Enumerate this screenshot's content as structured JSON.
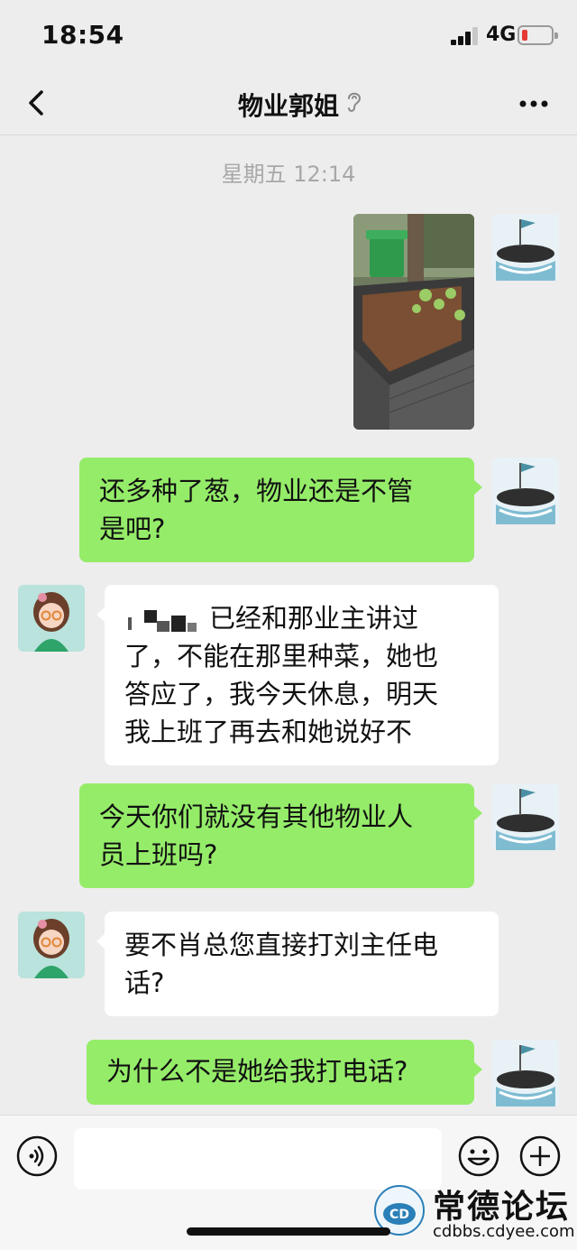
{
  "status_bar": {
    "time": "18:54",
    "network": "4G",
    "battery_level": 0.12,
    "battery_color": "#e53935"
  },
  "nav": {
    "back_icon": "chevron-left-icon",
    "title": "物业郭姐",
    "ear_icon": "ear-icon",
    "more_icon": "ellipsis-icon"
  },
  "chat": {
    "timestamp": "星期五 12:14",
    "messages": [
      {
        "sender": "me",
        "type": "image",
        "image_desc_icon": "photo-thumbnail"
      },
      {
        "sender": "me",
        "type": "text",
        "lines": [
          "还多种了葱，物业还是不管",
          "是吧?"
        ]
      },
      {
        "sender": "her",
        "type": "text",
        "lines": [
          "已经和那业主讲过",
          "了，不能在那里种菜，她也",
          "答应了，我今天休息，明天",
          "我上班了再去和她说好不"
        ]
      },
      {
        "sender": "me",
        "type": "text",
        "lines": [
          "今天你们就没有其他物业人",
          "员上班吗?"
        ]
      },
      {
        "sender": "her",
        "type": "text",
        "lines": [
          "要不肖总您直接打刘主任电",
          "话?"
        ]
      },
      {
        "sender": "me",
        "type": "text",
        "lines": [
          "为什么不是她给我打电话?"
        ]
      }
    ]
  },
  "input_bar": {
    "voice_icon": "voice-icon",
    "input_value": "",
    "emoji_icon": "emoji-icon",
    "plus_icon": "plus-icon"
  },
  "watermark": {
    "title": "常德论坛",
    "url": "cdbbs.cdyee.com",
    "logo_text": "常德论坛"
  },
  "colors": {
    "my_bubble": "#95ec69",
    "their_bubble": "#ffffff",
    "background": "#ededed"
  }
}
